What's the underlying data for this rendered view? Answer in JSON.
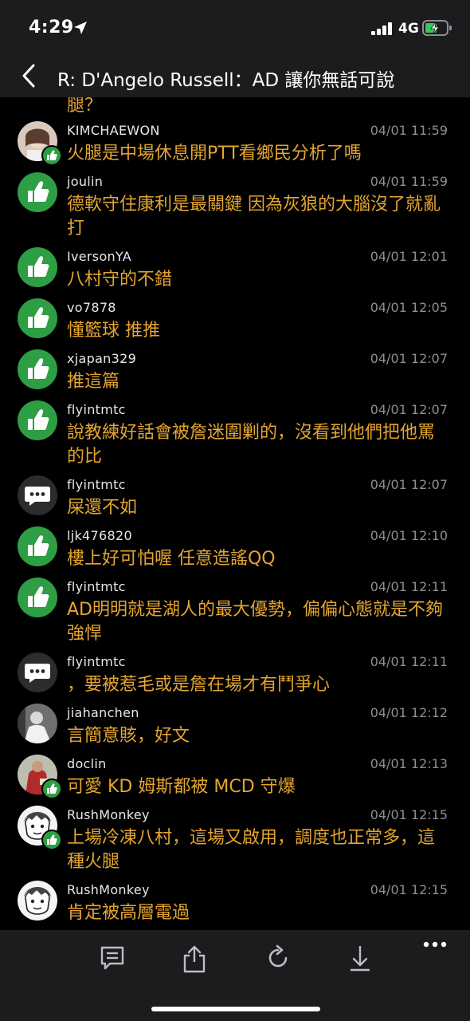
{
  "status_bar": {
    "time": "4:29",
    "network": "4G"
  },
  "nav": {
    "title": "R: D'Angelo Russell：AD 讓你無話可說"
  },
  "partial_top_text": "腿？",
  "comments": [
    {
      "user": "KIMCHAEWON",
      "date": "04/01 11:59",
      "text": "火腿是中場休息開PTT看鄉民分析了嗎",
      "avatar": "photo-girl",
      "reaction": "thumbs-up-badge"
    },
    {
      "user": "joulin",
      "date": "04/01 11:59",
      "text": "德軟守住康利是最關鍵 因為灰狼的大腦沒了就亂打",
      "avatar": "thumbs-up",
      "reaction": "thumbs-up"
    },
    {
      "user": "IversonYA",
      "date": "04/01 12:01",
      "text": "八村守的不錯",
      "avatar": "thumbs-up",
      "reaction": "thumbs-up"
    },
    {
      "user": "vo7878",
      "date": "04/01 12:05",
      "text": "懂籃球  推推",
      "avatar": "thumbs-up",
      "reaction": "thumbs-up"
    },
    {
      "user": "xjapan329",
      "date": "04/01 12:07",
      "text": "推這篇",
      "avatar": "thumbs-up",
      "reaction": "thumbs-up"
    },
    {
      "user": "flyintmtc",
      "date": "04/01 12:07",
      "text": "說教練好話會被詹迷圍剿的，沒看到他們把他罵的比",
      "avatar": "thumbs-up",
      "reaction": "thumbs-up"
    },
    {
      "user": "flyintmtc",
      "date": "04/01 12:07",
      "text": "屎還不如",
      "avatar": "message",
      "reaction": "comment"
    },
    {
      "user": "ljk476820",
      "date": "04/01 12:10",
      "text": "樓上好可怕喔 任意造謠QQ",
      "avatar": "thumbs-up",
      "reaction": "thumbs-up"
    },
    {
      "user": "flyintmtc",
      "date": "04/01 12:11",
      "text": "AD明明就是湖人的最大優勢，偏偏心態就是不夠強悍",
      "avatar": "thumbs-up",
      "reaction": "thumbs-up"
    },
    {
      "user": "flyintmtc",
      "date": "04/01 12:11",
      "text": "，要被惹毛或是詹在場才有鬥爭心",
      "avatar": "message",
      "reaction": "comment"
    },
    {
      "user": "jiahanchen",
      "date": "04/01 12:12",
      "text": "言簡意賅，好文",
      "avatar": "photo-bw",
      "reaction": "none"
    },
    {
      "user": "doclin",
      "date": "04/01 12:13",
      "text": "可愛 KD 姆斯都被 MCD 守爆",
      "avatar": "photo-red",
      "reaction": "thumbs-up-badge"
    },
    {
      "user": "RushMonkey",
      "date": "04/01 12:15",
      "text": "上場冷凍八村，這場又啟用，調度也正常多，這種火腿",
      "avatar": "photo-sketch",
      "reaction": "thumbs-up-badge"
    },
    {
      "user": "RushMonkey",
      "date": "04/01 12:15",
      "text": "肯定被高層電過",
      "avatar": "photo-sketch",
      "reaction": "none"
    }
  ],
  "toolbar": {
    "items": [
      "comment-icon",
      "share-icon",
      "refresh-icon",
      "download-icon",
      "more-icon"
    ]
  },
  "colors": {
    "comment_text": "#e3a530",
    "thumbs_up": "#2e9e44",
    "background": "#000000",
    "bar": "#1c1c1e",
    "date": "#8e8e93"
  }
}
